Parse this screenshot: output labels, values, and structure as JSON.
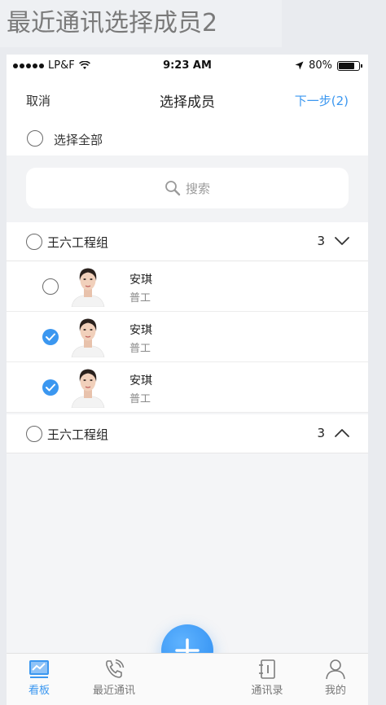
{
  "artboard": {
    "title": "最近通讯选择成员2"
  },
  "status_bar": {
    "carrier": "LP&F",
    "time": "9:23 AM",
    "battery": "80%"
  },
  "nav": {
    "cancel": "取消",
    "title": "选择成员",
    "next": "下一步(2)"
  },
  "select_all": {
    "label": "选择全部"
  },
  "search": {
    "placeholder": "搜索"
  },
  "groups": [
    {
      "name": "王六工程组",
      "count": "3",
      "expanded": true,
      "members": [
        {
          "name": "安琪",
          "role": "普工",
          "checked": false
        },
        {
          "name": "安琪",
          "role": "普工",
          "checked": true
        },
        {
          "name": "安琪",
          "role": "普工",
          "checked": true
        }
      ]
    },
    {
      "name": "王六工程组",
      "count": "3",
      "expanded": false
    }
  ],
  "tabs": [
    {
      "label": "看板",
      "icon": "dashboard-icon",
      "active": true
    },
    {
      "label": "最近通讯",
      "icon": "phone-icon",
      "active": false
    },
    {
      "label": "通讯录",
      "icon": "contacts-book-icon",
      "active": false
    },
    {
      "label": "我的",
      "icon": "user-icon",
      "active": false
    }
  ],
  "colors": {
    "accent": "#3b97f0",
    "background": "#f4f5f7"
  }
}
